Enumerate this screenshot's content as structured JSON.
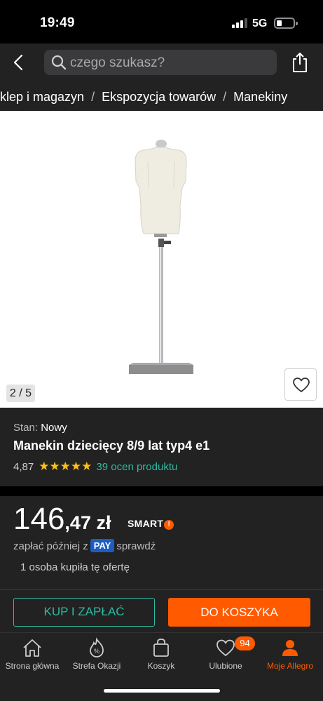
{
  "status": {
    "time": "19:49",
    "network": "5G"
  },
  "search": {
    "placeholder": "czego szukasz?"
  },
  "breadcrumb": [
    "klep i magazyn",
    "Ekspozycja towarów",
    "Manekiny"
  ],
  "gallery": {
    "counter": "2 / 5"
  },
  "product": {
    "condition_label": "Stan:",
    "condition_value": "Nowy",
    "title": "Manekin dziecięcy 8/9 lat typ4 e1",
    "rating_score": "4,87",
    "rating_stars": 5,
    "rating_count": "39 ocen produktu"
  },
  "price": {
    "whole": "146",
    "fraction": ",47 zł",
    "smart": "SMART",
    "paylater_prefix": "zapłać później z",
    "pay_badge": "PAY",
    "paylater_suffix": "sprawdź",
    "bought": "1 osoba kupiła tę ofertę"
  },
  "actions": {
    "buy": "KUP I ZAPŁAĆ",
    "cart": "DO KOSZYKA"
  },
  "tabs": [
    {
      "label": "Strona główna"
    },
    {
      "label": "Strefa Okazji"
    },
    {
      "label": "Koszyk"
    },
    {
      "label": "Ulubione",
      "badge": "94"
    },
    {
      "label": "Moje Allegro"
    }
  ],
  "colors": {
    "accent": "#ff5a00",
    "teal": "#2fbba3",
    "star": "#fbbf18",
    "pay": "#1d5dc3"
  }
}
